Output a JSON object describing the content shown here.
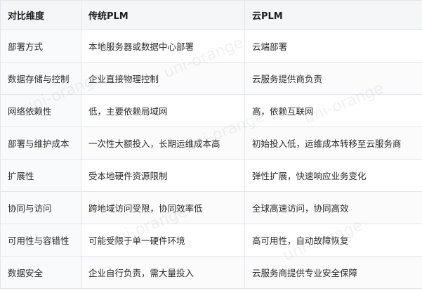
{
  "table": {
    "headers": [
      "对比维度",
      "传统PLM",
      "云PLM"
    ],
    "rows": [
      [
        "部署方式",
        "本地服务器或数据中心部署",
        "云端部署"
      ],
      [
        "数据存储与控制",
        "企业直接物理控制",
        "云服务提供商负责"
      ],
      [
        "网络依赖性",
        "低，主要依赖局域网",
        "高，依赖互联网"
      ],
      [
        "部署与维护成本",
        "一次性大额投入，长期运维成本高",
        "初始投入低，运维成本转移至云服务商"
      ],
      [
        "扩展性",
        "受本地硬件资源限制",
        "弹性扩展，快速响应业务变化"
      ],
      [
        "协同与访问",
        "跨地域访问受限，协同效率低",
        "全球高速访问，协同高效"
      ],
      [
        "可用性与容错性",
        "可能受限于单一硬件环境",
        "高可用性，自动故障恢复"
      ],
      [
        "数据安全",
        "企业自行负责，需大量投入",
        "云服务商提供专业安全保障"
      ]
    ]
  },
  "watermark": "uni-orange"
}
